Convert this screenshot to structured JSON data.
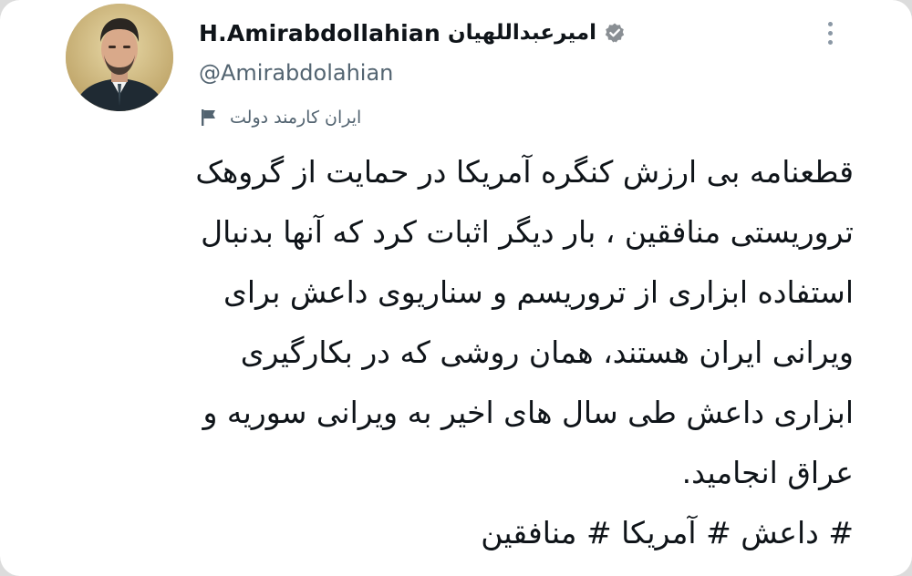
{
  "author": {
    "display_name": "H.Amirabdollahian",
    "display_name_fa": "امیرعبداللهیان",
    "handle": "@Amirabdolahian",
    "verified": true,
    "affiliation_label": "ایران کارمند دولت",
    "avatar": "profile-photo"
  },
  "tweet": {
    "lines": [
      "قطعنامه بی ارزش کنگره آمریکا در حمایت از گروهک",
      "تروریستی منافقین ، بار دیگر اثبات کرد که آنها بدنبال",
      "استفاده ابزاری از تروریسم و سناریوی داعش برای",
      "ویرانی ایران هستند، همان روشی که در بکارگیری",
      "ابزاری داعش طی سال های اخیر به ویرانی سوریه و",
      "عراق انجامید."
    ],
    "hashtags": "# داعش # آمریکا # منافقین"
  },
  "icons": {
    "verified": "verified-badge-icon",
    "affiliation": "flag-icon",
    "more": "more-options-icon"
  },
  "colors": {
    "text": "#0f1419",
    "secondary_text": "#536471",
    "verified_badge": "#8a8f94",
    "background": "#ffffff"
  }
}
